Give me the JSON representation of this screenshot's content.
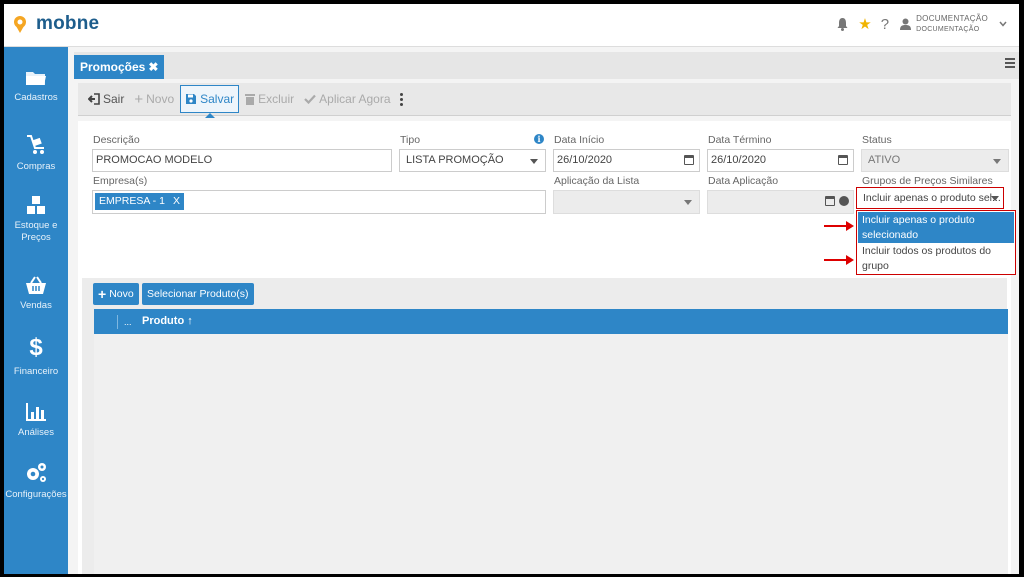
{
  "app": {
    "name": "mobne"
  },
  "header": {
    "user_name": "DOCUMENTAÇÃO",
    "user_org": "DOCUMENTAÇÃO",
    "help": "?"
  },
  "sidebar": {
    "items": [
      {
        "label": "Cadastros",
        "icon": "folder-icon"
      },
      {
        "label": "Compras",
        "icon": "cart-icon"
      },
      {
        "label": "Estoque e Preços",
        "icon": "boxes-icon"
      },
      {
        "label": "Vendas",
        "icon": "basket-icon"
      },
      {
        "label": "Financeiro",
        "icon": "dollar-icon"
      },
      {
        "label": "Análises",
        "icon": "bar-chart-icon"
      },
      {
        "label": "Configurações",
        "icon": "gears-icon"
      }
    ]
  },
  "tab": {
    "label": "Promoções",
    "close": "✖"
  },
  "toolbar": {
    "exit": "Sair",
    "new": "Novo",
    "save": "Salvar",
    "delete": "Excluir",
    "apply_now": "Aplicar Agora"
  },
  "form": {
    "descricao": {
      "label": "Descrição",
      "value": "PROMOCAO MODELO"
    },
    "tipo": {
      "label": "Tipo",
      "value": "LISTA PROMOÇÃO"
    },
    "data_inicio": {
      "label": "Data Início",
      "value": "26/10/2020"
    },
    "data_termino": {
      "label": "Data Término",
      "value": "26/10/2020"
    },
    "status": {
      "label": "Status",
      "value": "ATIVO"
    },
    "empresas": {
      "label": "Empresa(s)",
      "chip": "EMPRESA - 1",
      "chip_remove": "X"
    },
    "aplicacao_lista": {
      "label": "Aplicação da Lista",
      "value": ""
    },
    "data_aplicacao": {
      "label": "Data Aplicação",
      "value": ""
    },
    "grupos": {
      "label": "Grupos de Preços Similares",
      "value": "Incluir apenas o produto sel...",
      "options": [
        "Incluir apenas o produto selecionado",
        "Incluir todos os produtos do grupo"
      ]
    }
  },
  "grid": {
    "new_button": "Novo",
    "select_button": "Selecionar Produto(s)",
    "dots": "...",
    "column": "Produto"
  },
  "colors": {
    "accent": "#2e86c7",
    "highlight": "#cc0000"
  }
}
